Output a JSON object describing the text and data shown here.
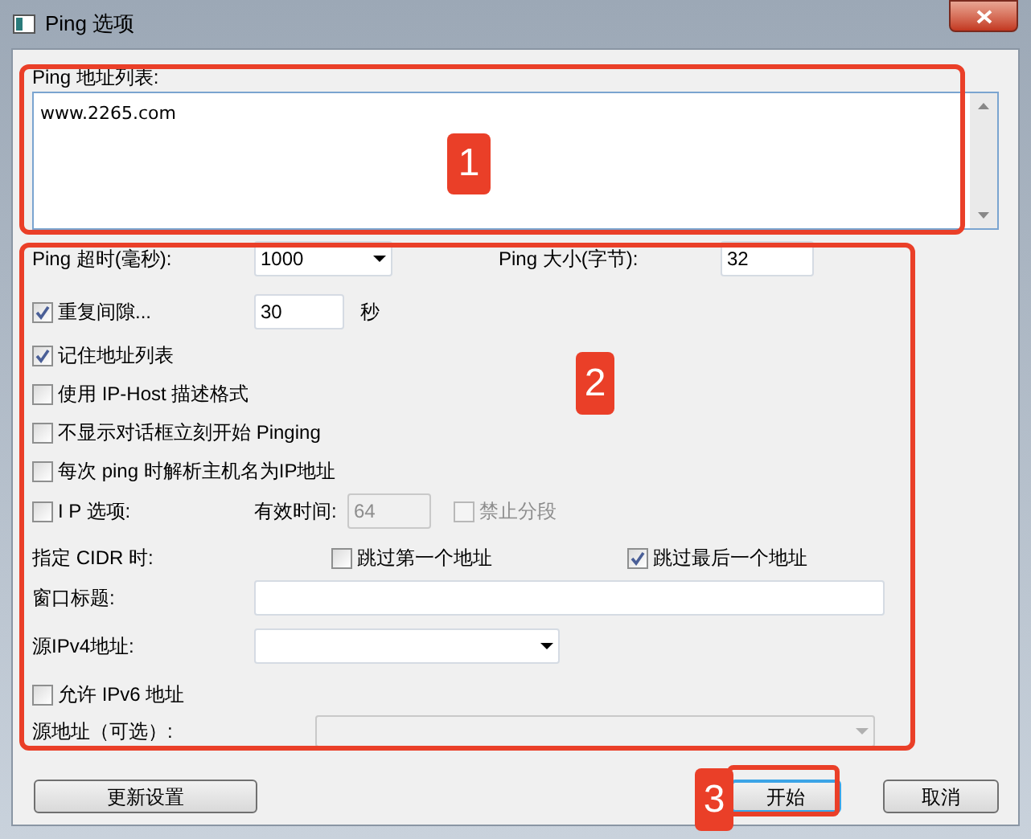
{
  "window": {
    "title": "Ping 选项"
  },
  "address_list": {
    "label": "Ping 地址列表:",
    "value": "www.2265.com"
  },
  "timeout": {
    "label": "Ping 超时(毫秒):",
    "value": "1000"
  },
  "size": {
    "label": "Ping 大小(字节):",
    "value": "32"
  },
  "repeat": {
    "label": "重复间隙...",
    "checked": true,
    "value": "30",
    "unit": "秒"
  },
  "checkboxes": [
    {
      "label": "记住地址列表",
      "checked": true
    },
    {
      "label": "使用 IP-Host 描述格式",
      "checked": false
    },
    {
      "label": "不显示对话框立刻开始 Pinging",
      "checked": false
    },
    {
      "label": "每次 ping 时解析主机名为IP地址",
      "checked": false
    }
  ],
  "ip_options": {
    "label": "I P 选项:",
    "checked": false,
    "ttl_label": "有效时间:",
    "ttl_value": "64",
    "disabled": true,
    "no_fragment": {
      "label": "禁止分段",
      "checked": false
    }
  },
  "cidr": {
    "label": "指定 CIDR 时:",
    "skip_first": {
      "label": "跳过第一个地址",
      "checked": false
    },
    "skip_last": {
      "label": "跳过最后一个地址",
      "checked": true
    }
  },
  "window_title": {
    "label": "窗口标题:"
  },
  "source_ipv4": {
    "label": "源IPv4地址:"
  },
  "allow_ipv6": {
    "label": "允许 IPv6 地址",
    "checked": false
  },
  "source_address": {
    "label": "源地址（可选）:",
    "disabled": true
  },
  "buttons": [
    {
      "label": "更新设置",
      "default": false
    },
    {
      "label": "开始",
      "default": true
    },
    {
      "label": "取消",
      "default": false
    }
  ],
  "annotations": [
    {
      "label": "1"
    },
    {
      "label": "2"
    },
    {
      "label": "3"
    }
  ]
}
